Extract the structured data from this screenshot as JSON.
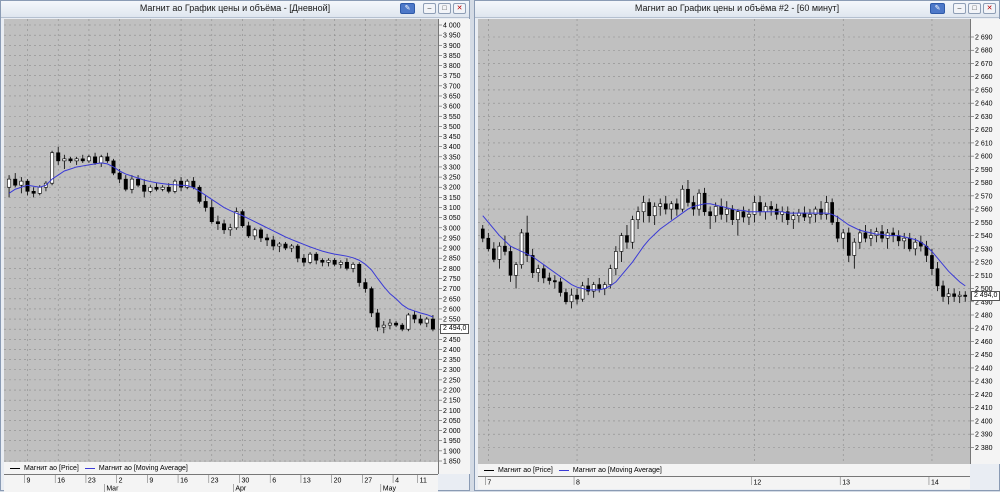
{
  "windows": [
    {
      "title": "Магнит ао График цены и объёма - [Дневной]",
      "last_price_label": "2 494,0",
      "legend": [
        {
          "label": "Магнит ао [Price]",
          "color": "#000000"
        },
        {
          "label": "Магнит ао [Moving Average]",
          "color": "#3a3ad6"
        }
      ]
    },
    {
      "title": "Магнит ао График цены и объёма #2 - [60 минут]",
      "last_price_label": "2 494,0",
      "legend": [
        {
          "label": "Магнит ао [Price]",
          "color": "#000000"
        },
        {
          "label": "Магнит ао [Moving Average]",
          "color": "#3a3ad6"
        }
      ]
    }
  ],
  "chart_data": [
    {
      "type": "candlestick",
      "timeframe": "Дневной",
      "ylim": [
        1850,
        4000
      ],
      "y_ticks": [
        "4 000",
        "3 950",
        "3 900",
        "3 850",
        "3 800",
        "3 750",
        "3 700",
        "3 650",
        "3 600",
        "3 550",
        "3 500",
        "3 450",
        "3 400",
        "3 350",
        "3 300",
        "3 250",
        "3 200",
        "3 150",
        "3 100",
        "3 050",
        "3 000",
        "2 950",
        "2 900",
        "2 850",
        "2 800",
        "2 750",
        "2 700",
        "2 650",
        "2 600",
        "2 550",
        "2 500",
        "2 450",
        "2 400",
        "2 350",
        "2 300",
        "2 250",
        "2 200",
        "2 150",
        "2 100",
        "2 050",
        "2 000",
        "1 950",
        "1 900",
        "1 850"
      ],
      "x_day_ticks": [
        {
          "i": 3,
          "label": "9"
        },
        {
          "i": 8,
          "label": "16"
        },
        {
          "i": 13,
          "label": "23"
        },
        {
          "i": 18,
          "label": "2"
        },
        {
          "i": 23,
          "label": "9"
        },
        {
          "i": 28,
          "label": "16"
        },
        {
          "i": 33,
          "label": "23"
        },
        {
          "i": 38,
          "label": "30"
        },
        {
          "i": 43,
          "label": "6"
        },
        {
          "i": 48,
          "label": "13"
        },
        {
          "i": 53,
          "label": "20"
        },
        {
          "i": 58,
          "label": "27"
        },
        {
          "i": 63,
          "label": "4"
        },
        {
          "i": 67,
          "label": "11"
        }
      ],
      "x_month_ticks": [
        {
          "i": 16,
          "label": "Mar"
        },
        {
          "i": 37,
          "label": "Apr"
        },
        {
          "i": 61,
          "label": "May"
        }
      ],
      "ohlc": [
        [
          3200,
          3260,
          3150,
          3240
        ],
        [
          3240,
          3270,
          3200,
          3210
        ],
        [
          3210,
          3250,
          3170,
          3230
        ],
        [
          3230,
          3240,
          3160,
          3180
        ],
        [
          3180,
          3200,
          3150,
          3170
        ],
        [
          3170,
          3210,
          3160,
          3200
        ],
        [
          3200,
          3230,
          3180,
          3220
        ],
        [
          3220,
          3380,
          3210,
          3370
        ],
        [
          3370,
          3400,
          3310,
          3330
        ],
        [
          3330,
          3360,
          3290,
          3340
        ],
        [
          3340,
          3350,
          3320,
          3330
        ],
        [
          3330,
          3350,
          3310,
          3340
        ],
        [
          3340,
          3360,
          3320,
          3330
        ],
        [
          3330,
          3360,
          3320,
          3350
        ],
        [
          3350,
          3370,
          3310,
          3320
        ],
        [
          3320,
          3360,
          3300,
          3350
        ],
        [
          3350,
          3370,
          3320,
          3330
        ],
        [
          3330,
          3340,
          3260,
          3270
        ],
        [
          3270,
          3290,
          3220,
          3240
        ],
        [
          3240,
          3260,
          3180,
          3190
        ],
        [
          3190,
          3260,
          3170,
          3240
        ],
        [
          3240,
          3260,
          3200,
          3210
        ],
        [
          3210,
          3240,
          3150,
          3180
        ],
        [
          3180,
          3210,
          3170,
          3200
        ],
        [
          3200,
          3220,
          3180,
          3190
        ],
        [
          3190,
          3210,
          3180,
          3200
        ],
        [
          3200,
          3220,
          3170,
          3180
        ],
        [
          3180,
          3240,
          3170,
          3230
        ],
        [
          3230,
          3250,
          3180,
          3200
        ],
        [
          3200,
          3240,
          3190,
          3230
        ],
        [
          3230,
          3250,
          3190,
          3200
        ],
        [
          3200,
          3210,
          3120,
          3130
        ],
        [
          3130,
          3160,
          3080,
          3100
        ],
        [
          3100,
          3140,
          3020,
          3030
        ],
        [
          3030,
          3060,
          2990,
          3020
        ],
        [
          3020,
          3040,
          2970,
          2990
        ],
        [
          2990,
          3020,
          2960,
          3000
        ],
        [
          3000,
          3100,
          2990,
          3080
        ],
        [
          3080,
          3090,
          3000,
          3010
        ],
        [
          3010,
          3030,
          2950,
          2960
        ],
        [
          2960,
          3000,
          2940,
          2990
        ],
        [
          2990,
          3000,
          2930,
          2950
        ],
        [
          2950,
          2970,
          2910,
          2940
        ],
        [
          2940,
          2960,
          2890,
          2910
        ],
        [
          2910,
          2930,
          2880,
          2920
        ],
        [
          2920,
          2930,
          2890,
          2900
        ],
        [
          2900,
          2920,
          2880,
          2910
        ],
        [
          2910,
          2920,
          2830,
          2850
        ],
        [
          2850,
          2870,
          2810,
          2830
        ],
        [
          2830,
          2880,
          2820,
          2870
        ],
        [
          2870,
          2880,
          2820,
          2840
        ],
        [
          2840,
          2850,
          2810,
          2830
        ],
        [
          2830,
          2850,
          2810,
          2840
        ],
        [
          2840,
          2850,
          2810,
          2820
        ],
        [
          2820,
          2840,
          2800,
          2830
        ],
        [
          2830,
          2850,
          2790,
          2800
        ],
        [
          2800,
          2830,
          2780,
          2820
        ],
        [
          2820,
          2830,
          2710,
          2730
        ],
        [
          2730,
          2750,
          2680,
          2700
        ],
        [
          2700,
          2710,
          2560,
          2580
        ],
        [
          2580,
          2600,
          2490,
          2510
        ],
        [
          2510,
          2540,
          2480,
          2520
        ],
        [
          2520,
          2550,
          2500,
          2530
        ],
        [
          2530,
          2540,
          2510,
          2520
        ],
        [
          2520,
          2530,
          2490,
          2500
        ],
        [
          2500,
          2580,
          2490,
          2570
        ],
        [
          2570,
          2590,
          2530,
          2550
        ],
        [
          2550,
          2570,
          2520,
          2530
        ],
        [
          2530,
          2560,
          2510,
          2550
        ],
        [
          2550,
          2570,
          2490,
          2500
        ]
      ],
      "moving_average": [
        3170,
        3190,
        3200,
        3210,
        3205,
        3200,
        3210,
        3240,
        3260,
        3280,
        3290,
        3300,
        3305,
        3310,
        3315,
        3320,
        3315,
        3300,
        3280,
        3265,
        3255,
        3245,
        3235,
        3228,
        3222,
        3218,
        3214,
        3212,
        3210,
        3208,
        3198,
        3180,
        3160,
        3140,
        3120,
        3100,
        3085,
        3072,
        3060,
        3045,
        3030,
        3015,
        3000,
        2985,
        2970,
        2955,
        2942,
        2930,
        2918,
        2906,
        2895,
        2885,
        2877,
        2870,
        2865,
        2860,
        2852,
        2840,
        2820,
        2792,
        2750,
        2710,
        2675,
        2650,
        2620,
        2600,
        2590,
        2580,
        2572,
        2560
      ]
    },
    {
      "type": "candlestick",
      "timeframe": "60 минут",
      "ylim": [
        2375,
        2690
      ],
      "y_ticks": [
        "2 690",
        "2 680",
        "2 670",
        "2 660",
        "2 650",
        "2 640",
        "2 630",
        "2 620",
        "2 610",
        "2 600",
        "2 590",
        "2 580",
        "2 570",
        "2 560",
        "2 550",
        "2 540",
        "2 530",
        "2 520",
        "2 510",
        "2 500",
        "2 490",
        "2 480",
        "2 470",
        "2 460",
        "2 450",
        "2 440",
        "2 430",
        "2 420",
        "2 410",
        "2 400",
        "2 390",
        "2 380"
      ],
      "x_day_ticks": [
        {
          "i": 1,
          "label": "7"
        },
        {
          "i": 17,
          "label": "8"
        },
        {
          "i": 49,
          "label": "12"
        },
        {
          "i": 65,
          "label": "13"
        },
        {
          "i": 81,
          "label": "14"
        }
      ],
      "x_month_ticks": [],
      "ohlc": [
        [
          2545,
          2548,
          2535,
          2538
        ],
        [
          2538,
          2542,
          2528,
          2530
        ],
        [
          2530,
          2535,
          2520,
          2522
        ],
        [
          2522,
          2535,
          2515,
          2532
        ],
        [
          2532,
          2540,
          2525,
          2528
        ],
        [
          2528,
          2532,
          2505,
          2510
        ],
        [
          2510,
          2520,
          2500,
          2518
        ],
        [
          2518,
          2545,
          2515,
          2542
        ],
        [
          2542,
          2555,
          2520,
          2525
        ],
        [
          2525,
          2530,
          2508,
          2512
        ],
        [
          2512,
          2518,
          2505,
          2515
        ],
        [
          2515,
          2518,
          2504,
          2508
        ],
        [
          2508,
          2512,
          2503,
          2506
        ],
        [
          2506,
          2510,
          2500,
          2505
        ],
        [
          2505,
          2508,
          2494,
          2497
        ],
        [
          2497,
          2500,
          2488,
          2490
        ],
        [
          2490,
          2500,
          2485,
          2495
        ],
        [
          2495,
          2500,
          2488,
          2492
        ],
        [
          2492,
          2505,
          2490,
          2502
        ],
        [
          2502,
          2508,
          2495,
          2498
        ],
        [
          2498,
          2505,
          2493,
          2503
        ],
        [
          2503,
          2508,
          2497,
          2500
        ],
        [
          2500,
          2505,
          2495,
          2503
        ],
        [
          2503,
          2518,
          2500,
          2515
        ],
        [
          2515,
          2532,
          2510,
          2528
        ],
        [
          2528,
          2542,
          2520,
          2540
        ],
        [
          2540,
          2548,
          2530,
          2535
        ],
        [
          2535,
          2555,
          2530,
          2552
        ],
        [
          2552,
          2562,
          2545,
          2558
        ],
        [
          2558,
          2570,
          2550,
          2565
        ],
        [
          2565,
          2568,
          2550,
          2555
        ],
        [
          2555,
          2565,
          2548,
          2562
        ],
        [
          2562,
          2568,
          2555,
          2564
        ],
        [
          2564,
          2570,
          2556,
          2560
        ],
        [
          2560,
          2566,
          2552,
          2564
        ],
        [
          2564,
          2568,
          2555,
          2560
        ],
        [
          2560,
          2578,
          2558,
          2575
        ],
        [
          2575,
          2582,
          2562,
          2565
        ],
        [
          2565,
          2570,
          2555,
          2560
        ],
        [
          2560,
          2575,
          2555,
          2572
        ],
        [
          2572,
          2576,
          2555,
          2558
        ],
        [
          2558,
          2562,
          2545,
          2555
        ],
        [
          2555,
          2565,
          2550,
          2562
        ],
        [
          2562,
          2568,
          2552,
          2556
        ],
        [
          2556,
          2566,
          2550,
          2560
        ],
        [
          2560,
          2563,
          2548,
          2552
        ],
        [
          2552,
          2560,
          2540,
          2558
        ],
        [
          2558,
          2562,
          2550,
          2554
        ],
        [
          2554,
          2560,
          2548,
          2556
        ],
        [
          2556,
          2570,
          2550,
          2565
        ],
        [
          2565,
          2570,
          2555,
          2558
        ],
        [
          2558,
          2565,
          2552,
          2562
        ],
        [
          2562,
          2566,
          2555,
          2560
        ],
        [
          2560,
          2564,
          2552,
          2556
        ],
        [
          2556,
          2562,
          2550,
          2558
        ],
        [
          2558,
          2562,
          2548,
          2552
        ],
        [
          2552,
          2558,
          2545,
          2555
        ],
        [
          2555,
          2560,
          2550,
          2557
        ],
        [
          2557,
          2562,
          2551,
          2554
        ],
        [
          2554,
          2560,
          2549,
          2556
        ],
        [
          2556,
          2562,
          2550,
          2560
        ],
        [
          2560,
          2566,
          2552,
          2556
        ],
        [
          2556,
          2570,
          2552,
          2565
        ],
        [
          2565,
          2568,
          2548,
          2550
        ],
        [
          2550,
          2555,
          2535,
          2538
        ],
        [
          2538,
          2545,
          2530,
          2542
        ],
        [
          2542,
          2546,
          2520,
          2525
        ],
        [
          2525,
          2538,
          2515,
          2535
        ],
        [
          2535,
          2545,
          2530,
          2542
        ],
        [
          2542,
          2548,
          2535,
          2538
        ],
        [
          2538,
          2545,
          2532,
          2540
        ],
        [
          2540,
          2546,
          2535,
          2543
        ],
        [
          2543,
          2548,
          2535,
          2538
        ],
        [
          2538,
          2545,
          2530,
          2542
        ],
        [
          2542,
          2546,
          2535,
          2540
        ],
        [
          2540,
          2544,
          2532,
          2536
        ],
        [
          2536,
          2542,
          2530,
          2538
        ],
        [
          2538,
          2542,
          2528,
          2530
        ],
        [
          2530,
          2538,
          2525,
          2535
        ],
        [
          2535,
          2540,
          2528,
          2532
        ],
        [
          2532,
          2536,
          2520,
          2525
        ],
        [
          2525,
          2530,
          2510,
          2515
        ],
        [
          2515,
          2520,
          2498,
          2502
        ],
        [
          2502,
          2506,
          2490,
          2494
        ],
        [
          2494,
          2500,
          2488,
          2496
        ],
        [
          2496,
          2500,
          2490,
          2494
        ],
        [
          2494,
          2498,
          2489,
          2495
        ],
        [
          2495,
          2498,
          2490,
          2494
        ]
      ],
      "moving_average": [
        2555,
        2550,
        2545,
        2540,
        2536,
        2532,
        2530,
        2528,
        2526,
        2524,
        2521,
        2518,
        2515,
        2512,
        2509,
        2506,
        2503,
        2501,
        2500,
        2499,
        2499,
        2499,
        2500,
        2502,
        2505,
        2510,
        2515,
        2520,
        2526,
        2532,
        2537,
        2541,
        2545,
        2548,
        2551,
        2554,
        2557,
        2560,
        2562,
        2563,
        2564,
        2564,
        2563,
        2562,
        2561,
        2560,
        2559,
        2559,
        2558,
        2558,
        2558,
        2558,
        2558,
        2558,
        2558,
        2557,
        2557,
        2557,
        2557,
        2557,
        2557,
        2557,
        2557,
        2556,
        2554,
        2551,
        2548,
        2546,
        2544,
        2543,
        2542,
        2541,
        2541,
        2540,
        2540,
        2540,
        2539,
        2538,
        2537,
        2535,
        2532,
        2528,
        2523,
        2518,
        2513,
        2509,
        2505,
        2502
      ]
    }
  ]
}
